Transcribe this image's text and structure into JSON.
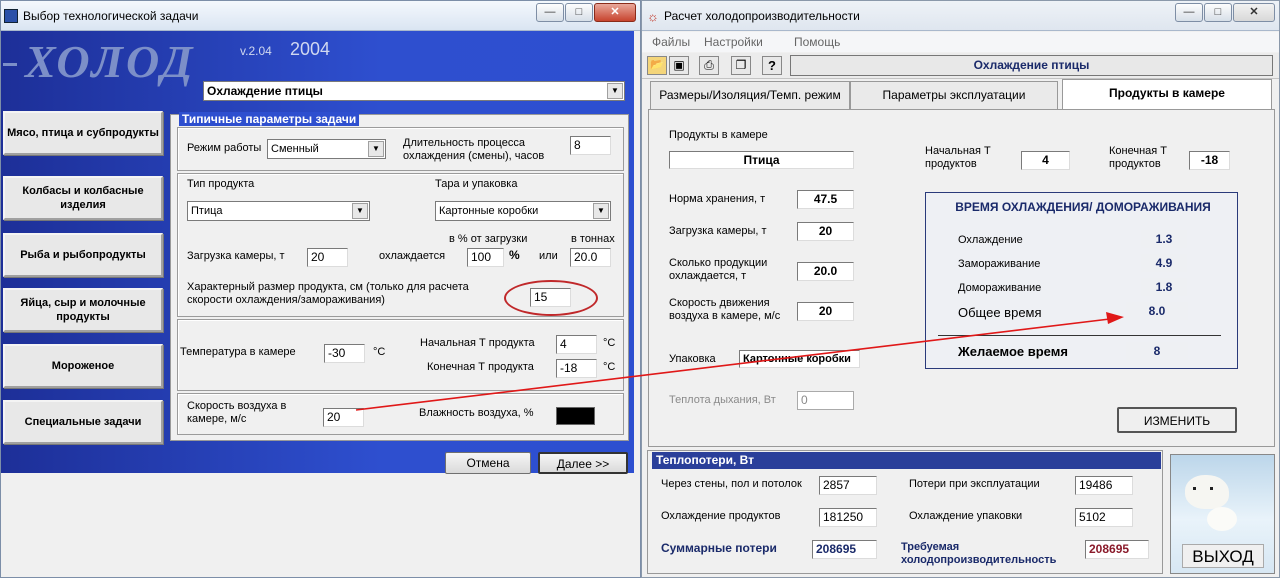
{
  "left": {
    "title": "Выбор технологической задачи",
    "logo": "ХОЛОД",
    "version": "v.2.04",
    "year": "2004",
    "task_select": "Охлаждение птицы",
    "categories": [
      "Мясо, птица и субпродукты",
      "Колбасы и колбасные изделия",
      "Рыба и рыбопродукты",
      "Яйца, сыр и молочные продукты",
      "Мороженое",
      "Специальные задачи"
    ],
    "group_title": "Типичные параметры задачи",
    "mode_label": "Режим работы",
    "mode_value": "Сменный",
    "duration_label": "Длительность процесса охлаждения (смены), часов",
    "duration_value": "8",
    "product_type_label": "Тип продукта",
    "product_type_value": "Птица",
    "pack_label": "Тара и упаковка",
    "pack_value": "Картонные коробки",
    "load_label": "Загрузка камеры, т",
    "load_value": "20",
    "pct_label": "в % от загрузки",
    "tons_label": "в тоннах",
    "cooled_label": "охлаждается",
    "pct_value": "100",
    "pct_unit": "%",
    "or_label": "или",
    "tons_value": "20.0",
    "size_label": "Характерный размер продукта, см (только для расчета скорости охлаждения/замораживания)",
    "size_value": "15",
    "temp_label": "Температура в камере",
    "temp_value": "-30",
    "unit_c": "°C",
    "start_t_label": "Начальная Т продукта",
    "start_t_value": "4",
    "end_t_label": "Конечная Т продукта",
    "end_t_value": "-18",
    "air_label": "Скорость воздуха в камере, м/с",
    "air_value": "20",
    "humidity_label": "Влажность воздуха, %",
    "cancel": "Отмена",
    "next": "Далее >>"
  },
  "right": {
    "title": "Расчет холодопроизводительности",
    "menu": [
      "Файлы",
      "Настройки",
      "Помощь"
    ],
    "header_field": "Охлаждение птицы",
    "tabs": [
      "Размеры/Изоляция/Темп. режим",
      "Параметры эксплуатации",
      "Продукты в камере"
    ],
    "products_label": "Продукты в камере",
    "products_value": "Птица",
    "start_t_label": "Начальная Т продуктов",
    "start_t_value": "4",
    "end_t_label": "Конечная Т продуктов",
    "end_t_value": "-18",
    "norm_label": "Норма хранения, т",
    "norm_value": "47.5",
    "load_label": "Загрузка камеры, т",
    "load_value": "20",
    "cooled_label": "Сколько продукции охлаждается, т",
    "cooled_value": "20.0",
    "air_label": "Скорость движения воздуха в камере, м/с",
    "air_value": "20",
    "pack_label": "Упаковка",
    "pack_value": "Картонные коробки",
    "heat_label": "Теплота дыхания, Вт",
    "heat_value": "0",
    "time_box": {
      "title": "ВРЕМЯ ОХЛАЖДЕНИЯ/ ДОМОРАЖИВАНИЯ",
      "rows": [
        {
          "label": "Охлаждение",
          "value": "1.3"
        },
        {
          "label": "Замораживание",
          "value": "4.9"
        },
        {
          "label": "Домораживание",
          "value": "1.8"
        },
        {
          "label": "Общее время",
          "value": "8.0"
        }
      ],
      "desired_label": "Желаемое время",
      "desired_value": "8"
    },
    "change": "ИЗМЕНИТЬ",
    "losses_title": "Теплопотери, Вт",
    "walls_label": "Через стены, пол и потолок",
    "walls_value": "2857",
    "op_label": "Потери при эксплуатации",
    "op_value": "19486",
    "cool_label": "Охлаждение продуктов",
    "cool_value": "181250",
    "packcool_label": "Охлаждение упаковки",
    "packcool_value": "5102",
    "sum_label": "Суммарные потери",
    "sum_value": "208695",
    "req_label": "Требуемая холодопроизводительность",
    "req_value": "208695",
    "exit": "ВЫХОД"
  }
}
